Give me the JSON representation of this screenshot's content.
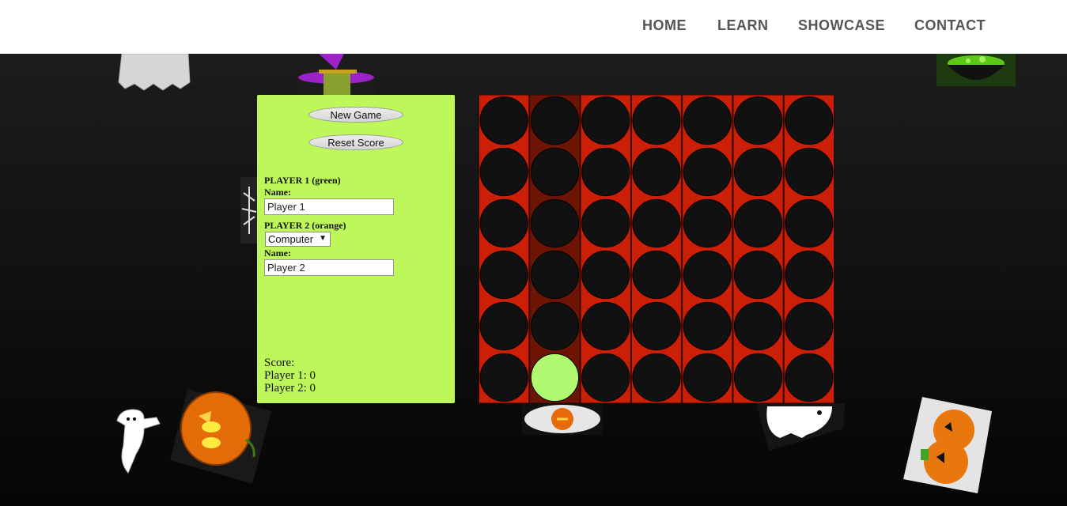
{
  "nav": {
    "items": [
      "HOME",
      "LEARN",
      "SHOWCASE",
      "CONTACT"
    ]
  },
  "controls": {
    "new_game": "New Game",
    "reset_score": "Reset Score"
  },
  "player1": {
    "heading": "PLAYER 1 (green)",
    "name_label": "Name:",
    "name_value": "Player 1"
  },
  "player2": {
    "heading": "PLAYER 2 (orange)",
    "type_value": "Computer",
    "name_label": "Name:",
    "name_value": "Player 2"
  },
  "score": {
    "title": "Score:",
    "p1": "Player 1: 0",
    "p2": "Player 2: 0"
  },
  "board": {
    "rows": 6,
    "cols": 7,
    "highlighted_column": 2,
    "pieces": [
      {
        "row": 6,
        "col": 2,
        "player": 1
      }
    ],
    "colors": {
      "frame": "#cc1f07",
      "column_highlight": "#6d1405",
      "empty": "#111111",
      "player1": "#b0f970",
      "player2": "#ff8c1a"
    }
  },
  "decorations": [
    "ghost-icon",
    "witch-icon",
    "cauldron-icon",
    "spider-icon",
    "ghost-with-moon-icon",
    "jack-o-lantern-icon",
    "lantern-icon",
    "ghost-icon",
    "pumpkins-icon"
  ]
}
